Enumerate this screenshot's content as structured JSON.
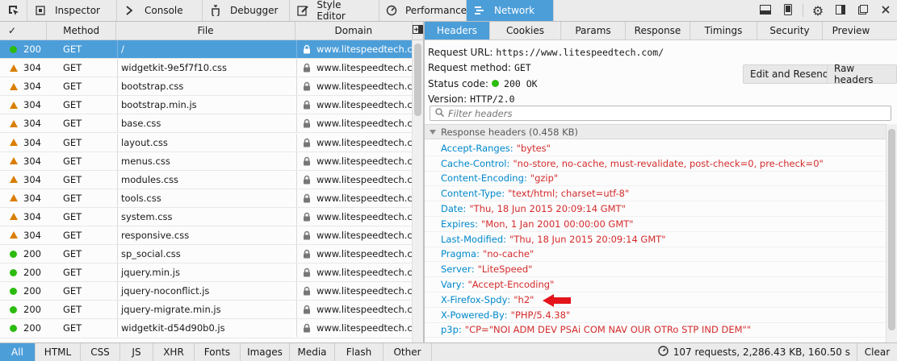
{
  "toolbar": {
    "tools": [
      {
        "label": "Inspector",
        "icon": "inspector-icon"
      },
      {
        "label": "Console",
        "icon": "console-icon"
      },
      {
        "label": "Debugger",
        "icon": "debugger-icon"
      },
      {
        "label": "Style Editor",
        "icon": "style-editor-icon"
      },
      {
        "label": "Performance",
        "icon": "performance-icon"
      },
      {
        "label": "Network",
        "icon": "network-icon",
        "selected": true
      }
    ],
    "right_icons": [
      "split-console-icon",
      "responsive-design-icon",
      "settings-icon",
      "dock-side-icon",
      "undock-icon",
      "close-icon"
    ]
  },
  "requests": {
    "columns": {
      "status": "✓",
      "method": "Method",
      "file": "File",
      "domain": "Domain"
    },
    "rows": [
      {
        "status": "200",
        "method": "GET",
        "file": "/",
        "domain": "www.litespeedtech.com",
        "selected": true
      },
      {
        "status": "304",
        "method": "GET",
        "file": "widgetkit-9e5f7f10.css",
        "domain": "www.litespeedtech.com"
      },
      {
        "status": "304",
        "method": "GET",
        "file": "bootstrap.css",
        "domain": "www.litespeedtech.com"
      },
      {
        "status": "304",
        "method": "GET",
        "file": "bootstrap.min.js",
        "domain": "www.litespeedtech.com"
      },
      {
        "status": "304",
        "method": "GET",
        "file": "base.css",
        "domain": "www.litespeedtech.com"
      },
      {
        "status": "304",
        "method": "GET",
        "file": "layout.css",
        "domain": "www.litespeedtech.com"
      },
      {
        "status": "304",
        "method": "GET",
        "file": "menus.css",
        "domain": "www.litespeedtech.com"
      },
      {
        "status": "304",
        "method": "GET",
        "file": "modules.css",
        "domain": "www.litespeedtech.com"
      },
      {
        "status": "304",
        "method": "GET",
        "file": "tools.css",
        "domain": "www.litespeedtech.com"
      },
      {
        "status": "304",
        "method": "GET",
        "file": "system.css",
        "domain": "www.litespeedtech.com"
      },
      {
        "status": "304",
        "method": "GET",
        "file": "responsive.css",
        "domain": "www.litespeedtech.com"
      },
      {
        "status": "200",
        "method": "GET",
        "file": "sp_social.css",
        "domain": "www.litespeedtech.com"
      },
      {
        "status": "200",
        "method": "GET",
        "file": "jquery.min.js",
        "domain": "www.litespeedtech.com"
      },
      {
        "status": "200",
        "method": "GET",
        "file": "jquery-noconflict.js",
        "domain": "www.litespeedtech.com"
      },
      {
        "status": "200",
        "method": "GET",
        "file": "jquery-migrate.min.js",
        "domain": "www.litespeedtech.com"
      },
      {
        "status": "200",
        "method": "GET",
        "file": "widgetkit-d54d90b0.js",
        "domain": "www.litespeedtech.com"
      }
    ]
  },
  "details": {
    "tabs": [
      "Headers",
      "Cookies",
      "Params",
      "Response",
      "Timings",
      "Security",
      "Preview"
    ],
    "request_url_label": "Request URL:",
    "request_url": "https://www.litespeedtech.com/",
    "request_method_label": "Request method:",
    "request_method": "GET",
    "status_code_label": "Status code:",
    "status_code": "200 OK",
    "version_label": "Version:",
    "version": "HTTP/2.0",
    "edit_resend": "Edit and Resend",
    "raw_headers": "Raw headers",
    "filter_placeholder": "Filter headers",
    "response_section": "Response headers (0.458 KB)",
    "response_headers": [
      {
        "name": "Accept-Ranges",
        "value": "bytes"
      },
      {
        "name": "Cache-Control",
        "value": "no-store, no-cache, must-revalidate, post-check=0, pre-check=0"
      },
      {
        "name": "Content-Encoding",
        "value": "gzip"
      },
      {
        "name": "Content-Type",
        "value": "text/html; charset=utf-8"
      },
      {
        "name": "Date",
        "value": "Thu, 18 Jun 2015 20:09:14 GMT"
      },
      {
        "name": "Expires",
        "value": "Mon, 1 Jan 2001 00:00:00 GMT"
      },
      {
        "name": "Last-Modified",
        "value": "Thu, 18 Jun 2015 20:09:14 GMT"
      },
      {
        "name": "Pragma",
        "value": "no-cache"
      },
      {
        "name": "Server",
        "value": "LiteSpeed"
      },
      {
        "name": "Vary",
        "value": "Accept-Encoding"
      },
      {
        "name": "X-Firefox-Spdy",
        "value": "h2"
      },
      {
        "name": "X-Powered-By",
        "value": "PHP/5.4.38"
      },
      {
        "name": "p3p",
        "value": "CP=\"NOI ADM DEV PSAi COM NAV OUR OTRo STP IND DEM\""
      }
    ]
  },
  "footer": {
    "filters": [
      "All",
      "HTML",
      "CSS",
      "JS",
      "XHR",
      "Fonts",
      "Images",
      "Media",
      "Flash",
      "Other"
    ],
    "summary": "107 requests, 2,286.43 KB, 160.50 s",
    "clear": "Clear"
  },
  "colors": {
    "accent": "#4c9ed9",
    "ok": "#2cbb0f",
    "redirect": "#d97e00",
    "header_name": "#0088cc",
    "header_value": "#d42b2b",
    "annotation_arrow": "#e3141b"
  }
}
